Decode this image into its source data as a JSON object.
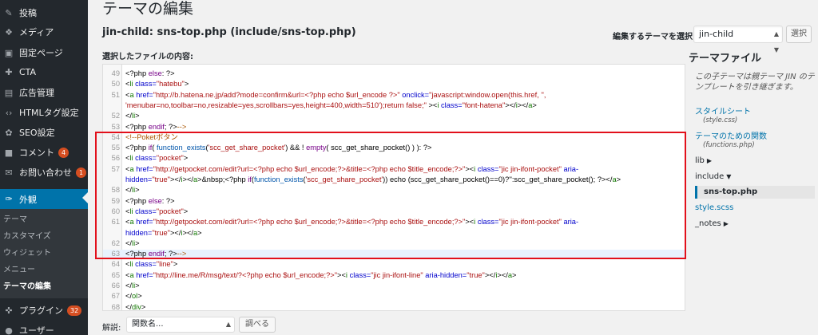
{
  "sidebar": {
    "items": [
      {
        "label": "投稿",
        "icon": "✎",
        "badge": ""
      },
      {
        "label": "メディア",
        "icon": "❖",
        "badge": ""
      },
      {
        "label": "固定ページ",
        "icon": "▣",
        "badge": ""
      },
      {
        "label": "CTA",
        "icon": "✚",
        "badge": ""
      },
      {
        "label": "広告管理",
        "icon": "▤",
        "badge": ""
      },
      {
        "label": "HTMLタグ設定",
        "icon": "‹›",
        "badge": ""
      },
      {
        "label": "SEO設定",
        "icon": "✿",
        "badge": ""
      },
      {
        "label": "コメント",
        "icon": "■",
        "badge": "4"
      },
      {
        "label": "お問い合わせ",
        "icon": "✉",
        "badge": "1"
      },
      {
        "label": "外観",
        "icon": "✑",
        "badge": ""
      },
      {
        "label": "プラグイン",
        "icon": "✜",
        "badge": "32"
      },
      {
        "label": "ユーザー",
        "icon": "●",
        "badge": ""
      }
    ],
    "submenu": [
      "テーマ",
      "カスタマイズ",
      "ウィジェット",
      "メニュー",
      "テーマの編集"
    ]
  },
  "header": {
    "title": "テーマの編集",
    "file_title": "jin-child: sns-top.php (include/sns-top.php)",
    "select_label": "編集するテーマを選択:",
    "selected_theme": "jin-child",
    "select_button": "選択",
    "content_label": "選択したファイルの内容:"
  },
  "editor": {
    "lines": [
      {
        "n": "49",
        "y": 0,
        "cur": false,
        "seg": [
          [
            "",
            "        <?php "
          ],
          [
            "k",
            "else"
          ],
          [
            "",
            ": ?>"
          ]
        ]
      },
      {
        "n": "50",
        "y": 1,
        "cur": false,
        "seg": [
          [
            "",
            "            <"
          ],
          [
            "t",
            "li"
          ],
          [
            "a",
            " class="
          ],
          [
            "s",
            "\"hatebu\""
          ],
          [
            "",
            ">"
          ]
        ]
      },
      {
        "n": "51",
        "y": 2,
        "cur": false,
        "seg": [
          [
            "",
            "                <"
          ],
          [
            "t",
            "a"
          ],
          [
            "a",
            " href="
          ],
          [
            "s",
            "\"http://b.hatena.ne.jp/add?mode=confirm&url=<?php echo $url_encode ?>\""
          ],
          [
            "a",
            " onclick="
          ],
          [
            "s",
            "\"javascript:window.open(this.href, '',"
          ],
          [
            "",
            ""
          ]
        ]
      },
      {
        "n": "",
        "y": 3,
        "cur": false,
        "seg": [
          [
            "s",
            "'menubar=no,toolbar=no,resizable=yes,scrollbars=yes,height=400,width=510');return false;\""
          ],
          [
            "",
            " ><"
          ],
          [
            "t",
            "i"
          ],
          [
            "a",
            " class="
          ],
          [
            "s",
            "\"font-hatena\""
          ],
          [
            "",
            "></"
          ],
          [
            "t",
            "i"
          ],
          [
            "",
            "></"
          ],
          [
            "t",
            "a"
          ],
          [
            "",
            ">"
          ]
        ]
      },
      {
        "n": "52",
        "y": 4,
        "cur": false,
        "seg": [
          [
            "",
            "            </"
          ],
          [
            "t",
            "li"
          ],
          [
            "",
            ">"
          ]
        ]
      },
      {
        "n": "53",
        "y": 5,
        "cur": false,
        "seg": [
          [
            "",
            "        <?php "
          ],
          [
            "k",
            "endif"
          ],
          [
            "",
            "; ?>"
          ],
          [
            "c",
            "-->"
          ]
        ]
      },
      {
        "n": "54",
        "y": 6,
        "cur": false,
        "seg": [
          [
            "c",
            "        <!--Poketボタン"
          ]
        ]
      },
      {
        "n": "55",
        "y": 7,
        "cur": false,
        "seg": [
          [
            "",
            "        <?php "
          ],
          [
            "k",
            "if"
          ],
          [
            "",
            "( "
          ],
          [
            "v",
            "function_exists"
          ],
          [
            "",
            "("
          ],
          [
            "s",
            "'scc_get_share_pocket'"
          ],
          [
            "",
            ") && ! "
          ],
          [
            "k",
            "empty"
          ],
          [
            "",
            "( scc_get_share_pocket() ) ): ?>"
          ]
        ]
      },
      {
        "n": "56",
        "y": 8,
        "cur": false,
        "seg": [
          [
            "",
            "            <"
          ],
          [
            "t",
            "li"
          ],
          [
            "a",
            " class="
          ],
          [
            "s",
            "\"pocket\""
          ],
          [
            "",
            ">"
          ]
        ]
      },
      {
        "n": "57",
        "y": 9,
        "cur": false,
        "seg": [
          [
            "",
            "                <"
          ],
          [
            "t",
            "a"
          ],
          [
            "a",
            " href="
          ],
          [
            "s",
            "\"http://getpocket.com/edit?url=<?php echo $url_encode;?>&title=<?php echo $title_encode;?>\""
          ],
          [
            "",
            "><"
          ],
          [
            "t",
            "i"
          ],
          [
            "a",
            " class="
          ],
          [
            "s",
            "\"jic jin-ifont-pocket\""
          ],
          [
            "a",
            " aria-"
          ]
        ]
      },
      {
        "n": "",
        "y": 10,
        "cur": false,
        "seg": [
          [
            "a",
            "hidden="
          ],
          [
            "s",
            "\"true\""
          ],
          [
            "",
            "></"
          ],
          [
            "t",
            "i"
          ],
          [
            "",
            "></"
          ],
          [
            "t",
            "a"
          ],
          [
            "",
            ">&nbsp;<?php "
          ],
          [
            "k",
            "if"
          ],
          [
            "",
            "("
          ],
          [
            "v",
            "function_exists"
          ],
          [
            "",
            "("
          ],
          [
            "s",
            "'scc_get_share_pocket'"
          ],
          [
            "",
            ")) echo (scc_get_share_pocket()==0)?'':scc_get_share_pocket(); ?></"
          ],
          [
            "t",
            "a"
          ],
          [
            "",
            ">"
          ]
        ]
      },
      {
        "n": "58",
        "y": 11,
        "cur": false,
        "seg": [
          [
            "",
            "            </"
          ],
          [
            "t",
            "li"
          ],
          [
            "",
            ">"
          ]
        ]
      },
      {
        "n": "59",
        "y": 12,
        "cur": false,
        "seg": [
          [
            "",
            "        <?php "
          ],
          [
            "k",
            "else"
          ],
          [
            "",
            ": ?>"
          ]
        ]
      },
      {
        "n": "60",
        "y": 13,
        "cur": false,
        "seg": [
          [
            "",
            "            <"
          ],
          [
            "t",
            "li"
          ],
          [
            "a",
            " class="
          ],
          [
            "s",
            "\"pocket\""
          ],
          [
            "",
            ">"
          ]
        ]
      },
      {
        "n": "61",
        "y": 14,
        "cur": false,
        "seg": [
          [
            "",
            "                <"
          ],
          [
            "t",
            "a"
          ],
          [
            "a",
            " href="
          ],
          [
            "s",
            "\"http://getpocket.com/edit?url=<?php echo $url_encode;?>&title=<?php echo $title_encode;?>\""
          ],
          [
            "",
            "><"
          ],
          [
            "t",
            "i"
          ],
          [
            "a",
            " class="
          ],
          [
            "s",
            "\"jic jin-ifont-pocket\""
          ],
          [
            "a",
            " aria-"
          ]
        ]
      },
      {
        "n": "",
        "y": 15,
        "cur": false,
        "seg": [
          [
            "a",
            "hidden="
          ],
          [
            "s",
            "\"true\""
          ],
          [
            "",
            "></"
          ],
          [
            "t",
            "i"
          ],
          [
            "",
            "></"
          ],
          [
            "t",
            "a"
          ],
          [
            "",
            ">"
          ]
        ]
      },
      {
        "n": "62",
        "y": 16,
        "cur": false,
        "seg": [
          [
            "",
            "            </"
          ],
          [
            "t",
            "li"
          ],
          [
            "",
            ">"
          ]
        ]
      },
      {
        "n": "63",
        "y": 17,
        "cur": true,
        "seg": [
          [
            "",
            "        <?php "
          ],
          [
            "k",
            "endif"
          ],
          [
            "",
            "; ?>"
          ],
          [
            "c",
            "-->"
          ]
        ]
      },
      {
        "n": "64",
        "y": 18,
        "cur": false,
        "seg": [
          [
            "",
            "            <"
          ],
          [
            "t",
            "li"
          ],
          [
            "a",
            " class="
          ],
          [
            "s",
            "\"line\""
          ],
          [
            "",
            ">"
          ]
        ]
      },
      {
        "n": "65",
        "y": 19,
        "cur": false,
        "seg": [
          [
            "",
            "            <"
          ],
          [
            "t",
            "a"
          ],
          [
            "a",
            " href="
          ],
          [
            "s",
            "\"http://line.me/R/msg/text/?<?php echo $url_encode;?>\""
          ],
          [
            "",
            "><"
          ],
          [
            "t",
            "i"
          ],
          [
            "a",
            " class="
          ],
          [
            "s",
            "\"jic jin-ifont-line\""
          ],
          [
            "a",
            " aria-hidden="
          ],
          [
            "s",
            "\"true\""
          ],
          [
            "",
            "></"
          ],
          [
            "t",
            "i"
          ],
          [
            "",
            "></"
          ],
          [
            "t",
            "a"
          ],
          [
            "",
            ">"
          ]
        ]
      },
      {
        "n": "66",
        "y": 20,
        "cur": false,
        "seg": [
          [
            "",
            "            </"
          ],
          [
            "t",
            "li"
          ],
          [
            "",
            ">"
          ]
        ]
      },
      {
        "n": "67",
        "y": 21,
        "cur": false,
        "seg": [
          [
            "",
            "        </"
          ],
          [
            "t",
            "ol"
          ],
          [
            "",
            ">"
          ]
        ]
      },
      {
        "n": "68",
        "y": 22,
        "cur": false,
        "seg": [
          [
            "",
            "    </"
          ],
          [
            "t",
            "div"
          ],
          [
            "",
            ">"
          ]
        ]
      }
    ]
  },
  "files": {
    "title": "テーマファイル",
    "note": "この子テーマは親テーマ JIN のテンプレートを引き継ぎます。",
    "items": [
      {
        "kind": "link",
        "label": "スタイルシート",
        "sub": "(style.css)"
      },
      {
        "kind": "link",
        "label": "テーマのための関数",
        "sub": "(functions.php)"
      },
      {
        "kind": "folder",
        "label": "lib"
      },
      {
        "kind": "folder",
        "label": "include"
      },
      {
        "kind": "current",
        "label": "sns-top.php"
      },
      {
        "kind": "link",
        "label": "style.scss"
      },
      {
        "kind": "folder",
        "label": "_notes"
      }
    ]
  },
  "footer": {
    "doc_label": "解説:",
    "doc_placeholder": "関数名...",
    "lookup_button": "調べる"
  },
  "colors": {
    "sidebar_bg": "#23282d",
    "active_bg": "#0073aa",
    "highlight_border": "#e2101b",
    "badge": "#d54e21"
  }
}
